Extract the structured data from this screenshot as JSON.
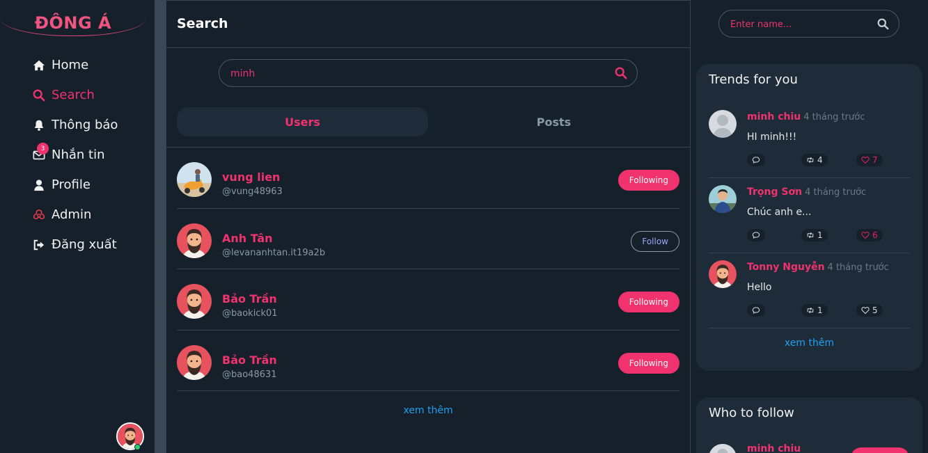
{
  "sidebar": {
    "logo": "ĐÔNG Á",
    "items": [
      {
        "label": "Home",
        "icon": "home-icon"
      },
      {
        "label": "Search",
        "icon": "search-icon"
      },
      {
        "label": "Thông báo",
        "icon": "bell-icon"
      },
      {
        "label": "Nhắn tin",
        "icon": "envelope-icon",
        "badge": "3"
      },
      {
        "label": "Profile",
        "icon": "user-icon"
      },
      {
        "label": "Admin",
        "icon": "biohazard-icon"
      },
      {
        "label": "Đăng xuất",
        "icon": "sign-out-icon"
      }
    ]
  },
  "main": {
    "title": "Search",
    "search": {
      "value": "minh"
    },
    "tabs": [
      {
        "label": "Users"
      },
      {
        "label": "Posts"
      }
    ],
    "users": [
      {
        "name": "vung lien",
        "handle": "@vung48963",
        "button": "Following"
      },
      {
        "name": "Anh Tân",
        "handle": "@levananhtan.it19a2b",
        "button": "Follow"
      },
      {
        "name": "Bảo Trần",
        "handle": "@baokick01",
        "button": "Following"
      },
      {
        "name": "Bảo Trần",
        "handle": "@bao48631",
        "button": "Following"
      }
    ],
    "more": "xem thêm"
  },
  "right": {
    "search": {
      "placeholder": "Enter name..."
    },
    "trends": {
      "title": "Trends for you",
      "items": [
        {
          "name": "minh chiu",
          "time": "4 tháng trước",
          "text": "HI minh!!!",
          "retweets": "4",
          "likes": "7",
          "liked": true
        },
        {
          "name": "Trọng Sơn",
          "time": "4 tháng trước",
          "text": "Chúc anh e...",
          "retweets": "1",
          "likes": "6",
          "liked": true
        },
        {
          "name": "Tonny Nguyễn",
          "time": "4 tháng trước",
          "text": "Hello",
          "retweets": "1",
          "likes": "5",
          "liked": false
        }
      ],
      "more": "xem thêm"
    },
    "who_to_follow": {
      "title": "Who to follow",
      "items": [
        {
          "name": "minh chiu"
        }
      ]
    }
  },
  "colors": {
    "accent": "#f0336e",
    "background": "#15202b",
    "card": "#1e2b38",
    "link": "#1da1f2"
  }
}
